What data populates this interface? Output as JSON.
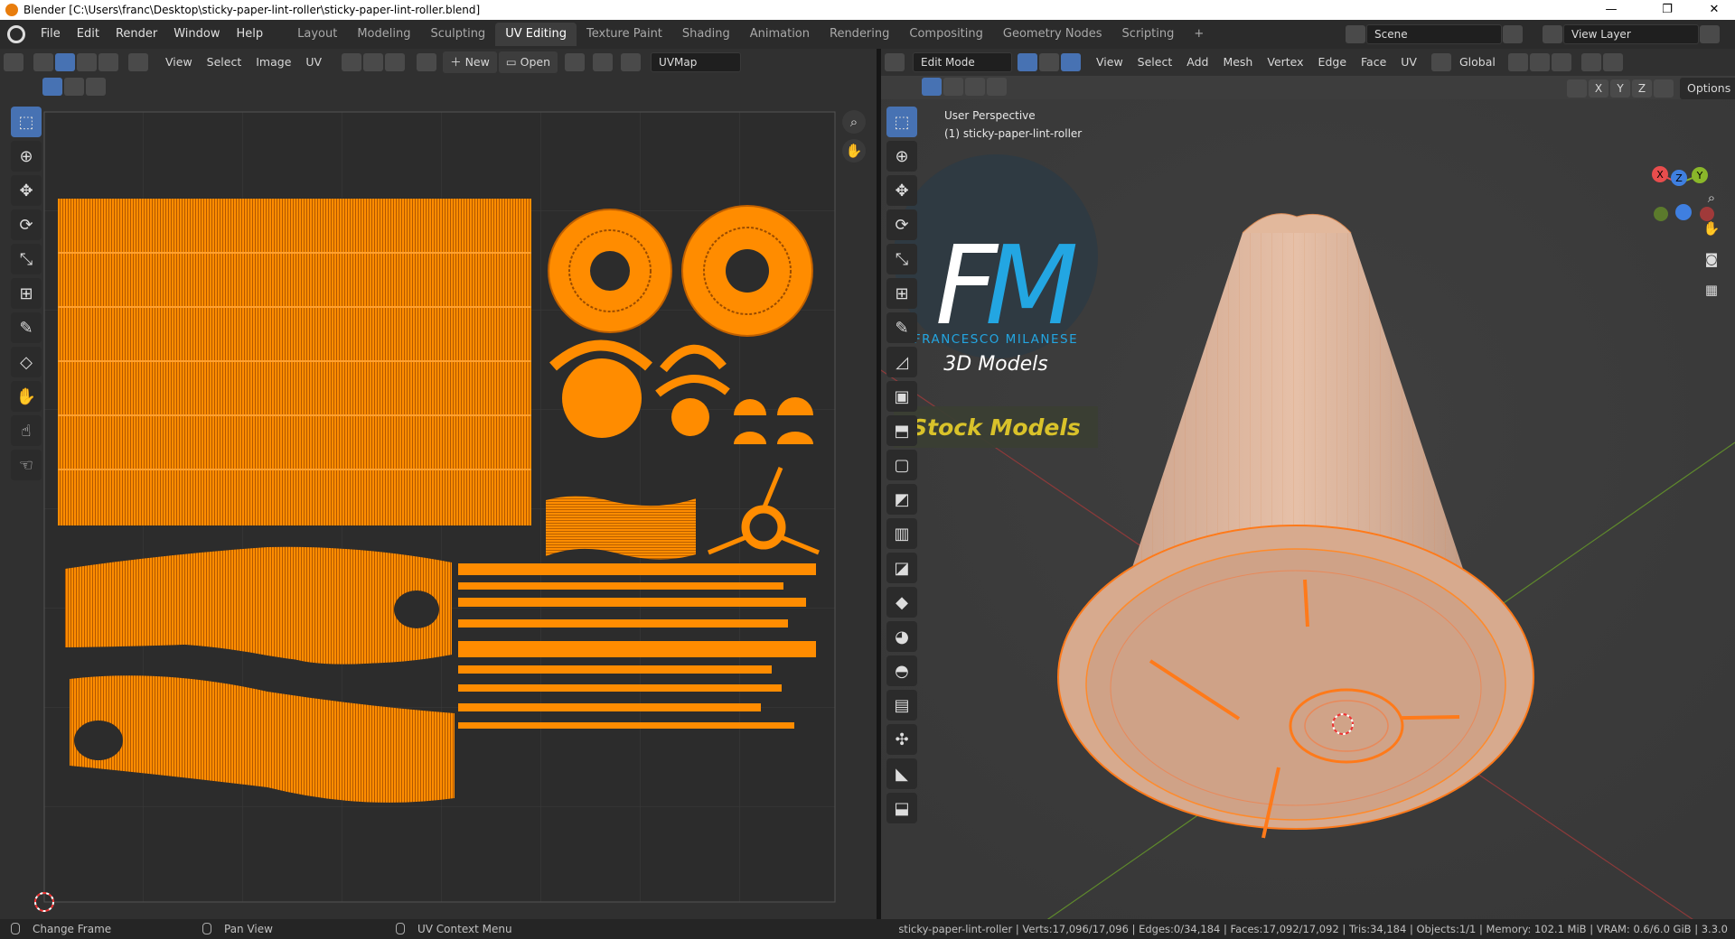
{
  "window": {
    "title": "Blender [C:\\Users\\franc\\Desktop\\sticky-paper-lint-roller\\sticky-paper-lint-roller.blend]",
    "minimize": "—",
    "maximize": "❐",
    "close": "✕"
  },
  "menu": [
    "File",
    "Edit",
    "Render",
    "Window",
    "Help"
  ],
  "workspaces": [
    "Layout",
    "Modeling",
    "Sculpting",
    "UV Editing",
    "Texture Paint",
    "Shading",
    "Animation",
    "Rendering",
    "Compositing",
    "Geometry Nodes",
    "Scripting",
    "+"
  ],
  "scene": "Scene",
  "view_layer": "View Layer",
  "uv_header": {
    "view": "View",
    "select": "Select",
    "image": "Image",
    "uv": "UV",
    "new": "New",
    "open": "Open",
    "uvmap": "UVMap"
  },
  "vp_header": {
    "mode": "Edit Mode",
    "view": "View",
    "select": "Select",
    "add": "Add",
    "mesh": "Mesh",
    "vertex": "Vertex",
    "edge": "Edge",
    "face": "Face",
    "uv": "UV",
    "orientation": "Global",
    "options": "Options",
    "axes": [
      "X",
      "Y",
      "Z"
    ]
  },
  "viewport": {
    "perspective": "User Perspective",
    "object": "(1) sticky-paper-lint-roller"
  },
  "gizmo": {
    "x": "X",
    "y": "Y",
    "z": "Z"
  },
  "watermark": {
    "monogram_f": "F",
    "monogram_m": "M",
    "author": "FRANCESCO MILANESE",
    "models": "3D Models",
    "stock": "Stock Models"
  },
  "status": {
    "left1": "Change Frame",
    "left2": "Pan View",
    "left3": "UV Context Menu",
    "right": "sticky-paper-lint-roller | Verts:17,096/17,096 | Edges:0/34,184 | Faces:17,092/17,092 | Tris:34,184 | Objects:1/1 | Memory: 102.1 MiB | VRAM: 0.6/6.0 GiB | 3.3.0"
  },
  "colors": {
    "accent": "#4772b3",
    "uv_orange": "#ff8c00",
    "mesh_orange": "#e58a3a"
  }
}
